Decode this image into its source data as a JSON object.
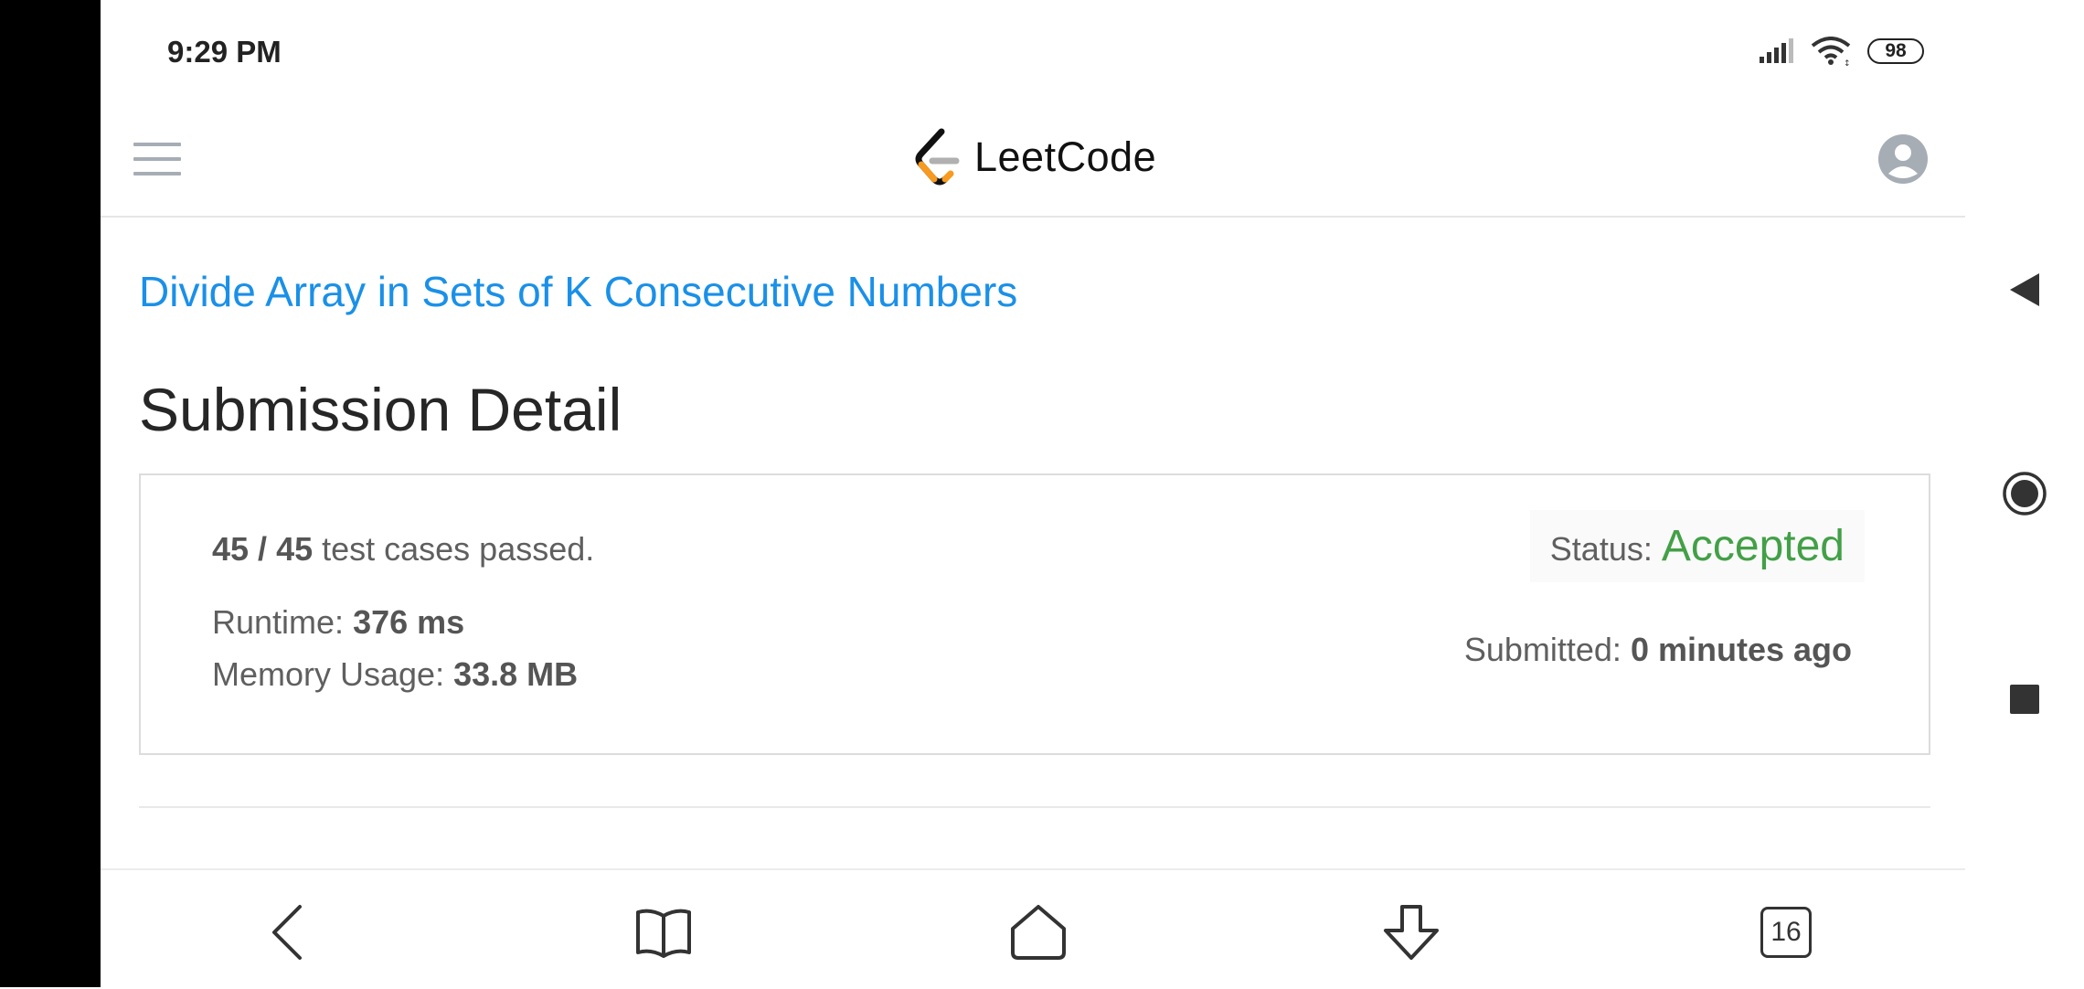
{
  "status_bar": {
    "time": "9:29 PM",
    "battery": "98",
    "icons": [
      "signal-icon",
      "wifi-icon",
      "battery-icon"
    ]
  },
  "header": {
    "logo_text": "LeetCode",
    "icons": [
      "menu-icon",
      "avatar-icon"
    ]
  },
  "problem": {
    "title": "Divide Array in Sets of K Consecutive Numbers"
  },
  "page": {
    "title": "Submission Detail"
  },
  "submission": {
    "passed": "45",
    "slash": " / ",
    "total": "45",
    "cases_suffix": " test cases passed.",
    "runtime_label": "Runtime: ",
    "runtime_value": "376 ms",
    "memory_label": "Memory Usage: ",
    "memory_value": "33.8 MB",
    "status_label": "Status:",
    "status_value": "Accepted",
    "submitted_label": "Submitted: ",
    "submitted_value": "0 minutes ago"
  },
  "toolbar": {
    "tab_count": "16",
    "icons": [
      "back-icon",
      "bookmarks-icon",
      "home-icon",
      "download-icon",
      "tabs-icon"
    ]
  },
  "colors": {
    "link": "#1a90e8",
    "accepted": "#43a047"
  }
}
